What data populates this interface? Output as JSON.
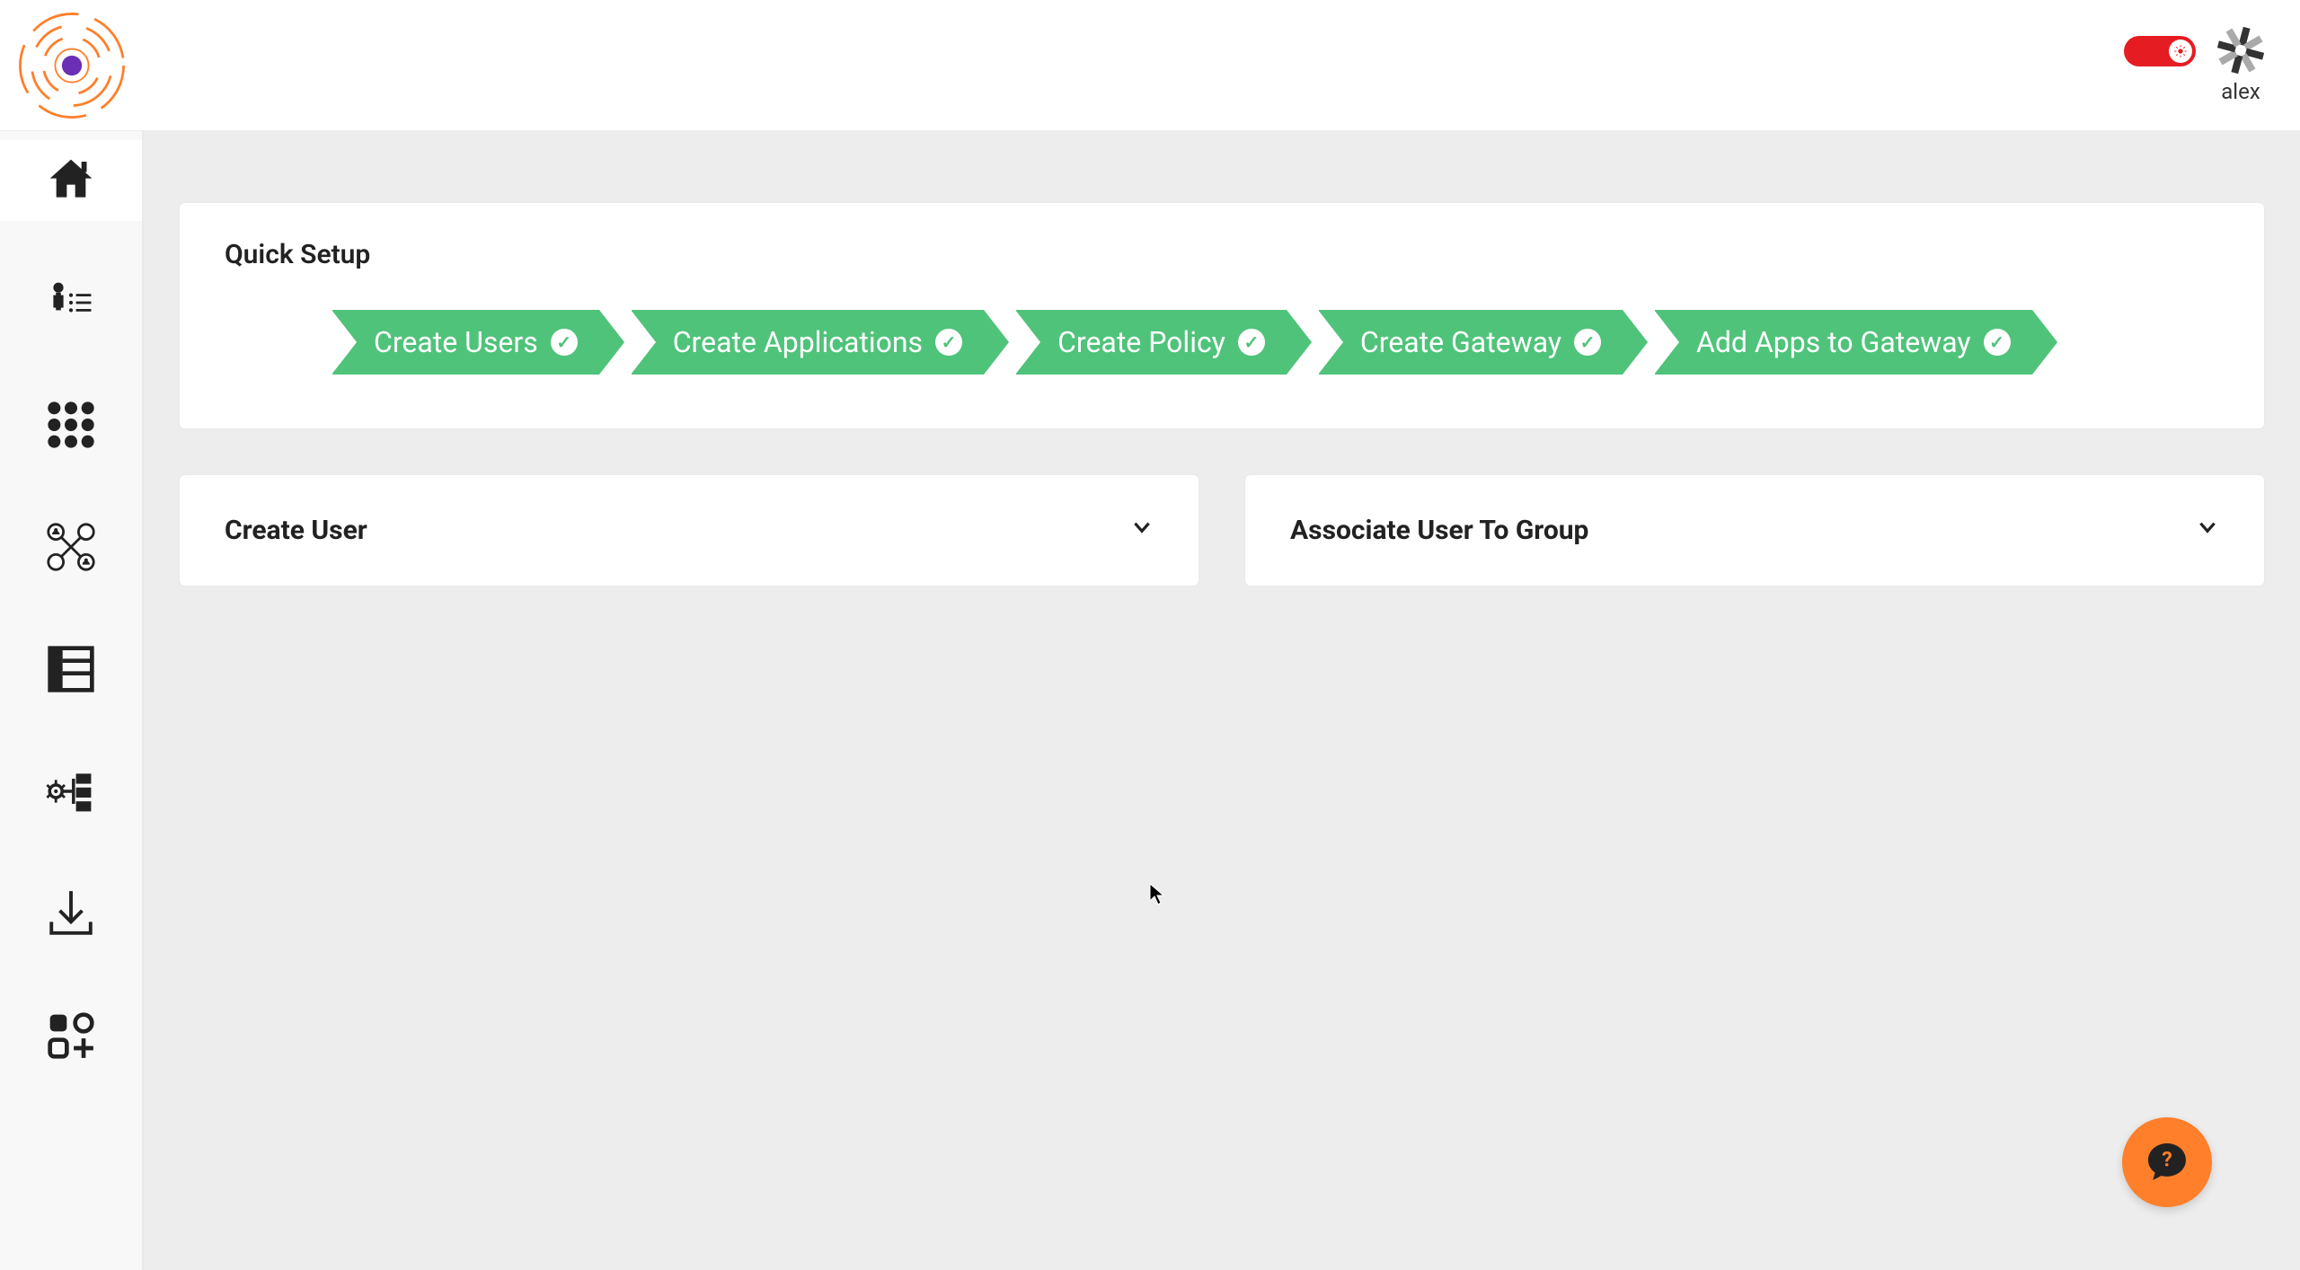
{
  "header": {
    "username": "alex"
  },
  "sidebar": {
    "items": [
      {
        "name": "home"
      },
      {
        "name": "users"
      },
      {
        "name": "apps-grid"
      },
      {
        "name": "user-groups"
      },
      {
        "name": "policy"
      },
      {
        "name": "settings-tree"
      },
      {
        "name": "downloads"
      },
      {
        "name": "add-module"
      }
    ]
  },
  "quick_setup": {
    "title": "Quick Setup",
    "steps": [
      {
        "label": "Create Users"
      },
      {
        "label": "Create Applications"
      },
      {
        "label": "Create Policy"
      },
      {
        "label": "Create Gateway"
      },
      {
        "label": "Add Apps to Gateway"
      }
    ]
  },
  "panels": {
    "create_user_title": "Create User",
    "associate_title": "Associate User To Group"
  }
}
